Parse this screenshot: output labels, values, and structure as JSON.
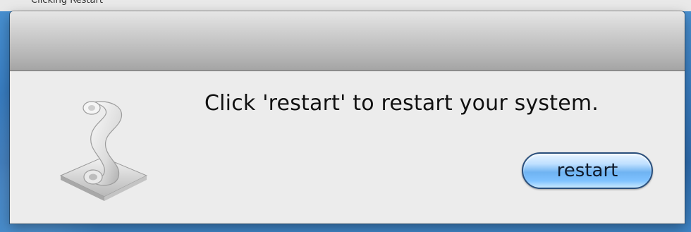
{
  "top_fragment": {
    "text": "Clicking Restart"
  },
  "dialog": {
    "message": "Click 'restart' to restart your system.",
    "icon": "script-scroll-icon",
    "button_label": "restart"
  },
  "colors": {
    "desktop": "#3a7fc3",
    "titlebar": "#b6b6b6",
    "content": "#ececec",
    "button_blue": "#6fb3f2"
  }
}
